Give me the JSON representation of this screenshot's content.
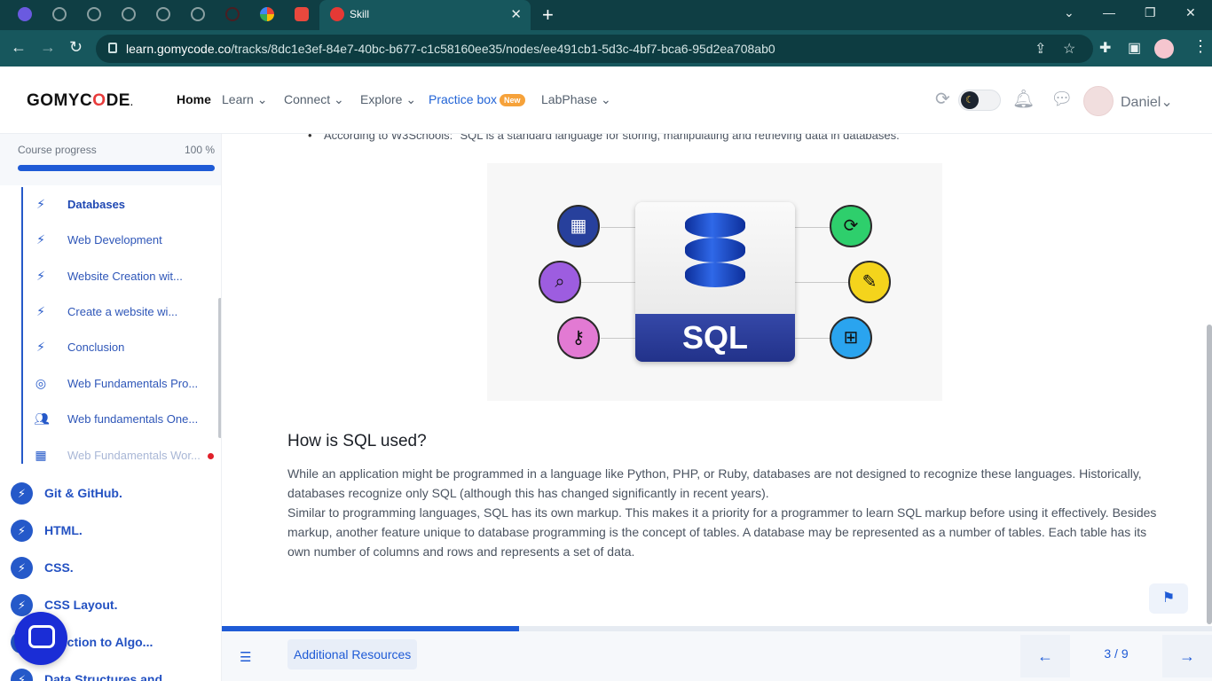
{
  "browser": {
    "active_tab_title": "Skill",
    "tab_close": "✕",
    "new_tab": "+",
    "url_host": "learn.gomycode.co",
    "url_path": "/tracks/8dc1e3ef-84e7-40bc-b677-c1c58160ee35/nodes/ee491cb1-5d3c-4bf7-bca6-95d2ea708ab0",
    "controls": {
      "minimize": "—",
      "restore": "❐",
      "close": "✕",
      "chevron": "⌄"
    }
  },
  "header": {
    "logo": {
      "pre": "GOMYC",
      "o": "O",
      "post": "DE",
      "mark": "."
    },
    "nav": {
      "home": "Home",
      "learn": "Learn ⌄",
      "connect": "Connect ⌄",
      "explore": "Explore ⌄",
      "practice": "Practice box",
      "practice_badge": "New",
      "labphase": "LabPhase ⌄"
    },
    "user": "Daniel⌄"
  },
  "sidebar": {
    "progress_label": "Course progress",
    "progress_value": "100 %",
    "progress_fraction": 1.0,
    "lessons": [
      {
        "label": "Databases",
        "icon": "bolt-icon"
      },
      {
        "label": "Web Development",
        "icon": "bolt-icon"
      },
      {
        "label": "Website Creation wit...",
        "icon": "bolt-icon"
      },
      {
        "label": "Create a website wi...",
        "icon": "bolt-icon"
      },
      {
        "label": "Conclusion",
        "icon": "bolt-icon"
      },
      {
        "label": "Web Fundamentals Pro...",
        "icon": "target-icon"
      },
      {
        "label": "Web fundamentals One...",
        "icon": "people-icon"
      },
      {
        "label": "Web Fundamentals Wor...",
        "icon": "workshop-icon"
      }
    ],
    "modules": [
      "Git & GitHub.",
      "HTML.",
      "CSS.",
      "CSS Layout.",
      "oduction to Algo...",
      "Data Structures and"
    ]
  },
  "content": {
    "bullet": "According to W3Schools: \"SQL is a standard language for storing, manipulating and retrieving data in databases.\"",
    "image_label": "SQL",
    "section_title": "How is SQL used?",
    "paragraph_1": "While an application might be programmed in a language like Python, PHP, or Ruby, databases are not designed to recognize these languages. Historically, databases recognize only SQL (although this has changed significantly in recent years).",
    "paragraph_2": "Similar to programming languages, SQL has its own markup. This makes it a priority for a programmer to learn SQL markup before using it effectively. Besides markup, another feature unique to database programming is the concept of tables. A database may be represented as a number of tables. Each table has its own number of columns and rows and represents a set of data."
  },
  "footer": {
    "additional_resources": "Additional Resources",
    "page_indicator": "3 / 9",
    "page_progress_fraction": 0.3
  },
  "colors": {
    "accent": "#1f5bd6",
    "chrome": "#17575d",
    "tabstrip": "#0f3e44",
    "logo_o": "#e83b3b"
  }
}
